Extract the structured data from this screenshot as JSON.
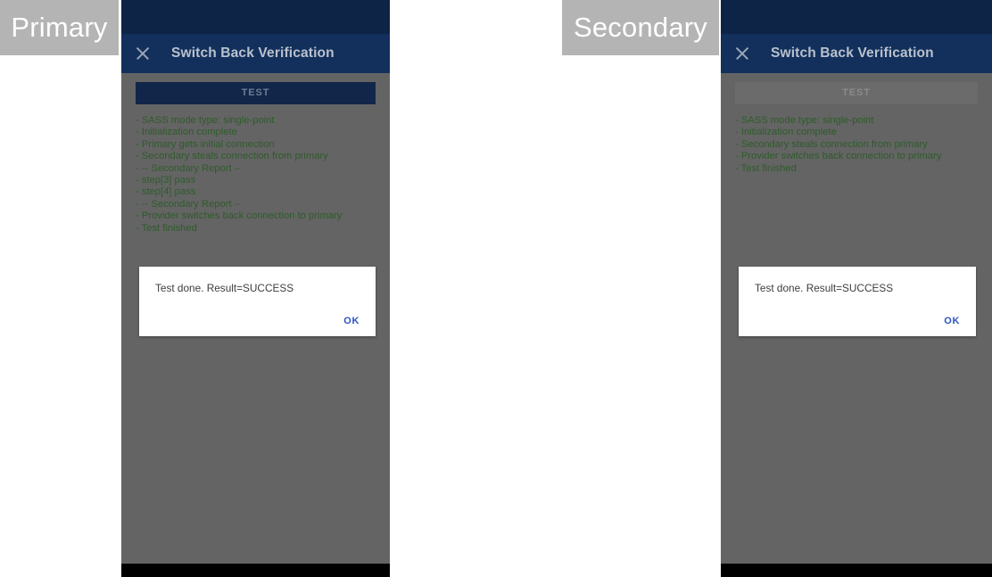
{
  "labels": {
    "primary": "Primary",
    "secondary": "Secondary"
  },
  "icons": {
    "close": "close-icon"
  },
  "panels": {
    "primary": {
      "role": "Primary",
      "appbar": {
        "title": "Switch Back Verification",
        "close_label": "Close"
      },
      "test_button": {
        "label": "TEST",
        "enabled": true
      },
      "log_lines": [
        "- SASS mode type: single-point",
        "- Initialization complete",
        "- Primary gets initial connection",
        "- Secondary steals connection from primary",
        "- -- Secondary Report --",
        "- step[3] pass",
        "- step[4] pass",
        "- -- Secondary Report --",
        "- Provider switches back connection to primary",
        "- Test finished"
      ],
      "dialog": {
        "message": "Test done. Result=SUCCESS",
        "ok_label": "OK"
      }
    },
    "secondary": {
      "role": "Secondary",
      "appbar": {
        "title": "Switch Back Verification",
        "close_label": "Close"
      },
      "test_button": {
        "label": "TEST",
        "enabled": false
      },
      "log_lines": [
        "- SASS mode type: single-point",
        "- Initialization complete",
        "- Secondary steals connection from primary",
        "- Provider switches back connection to primary",
        "- Test finished"
      ],
      "dialog": {
        "message": "Test done. Result=SUCCESS",
        "ok_label": "OK"
      }
    }
  },
  "colors": {
    "statusbar": "#0e2447",
    "appbar": "#13305c",
    "body": "#646464",
    "button_enabled": "#12264a",
    "button_disabled": "#6b6b6b",
    "log_text": "#2e5c2a",
    "dialog_bg": "#ffffff",
    "ok_text": "#2b53c6",
    "chip_bg": "#b4b4b4",
    "navbar": "#000000"
  }
}
